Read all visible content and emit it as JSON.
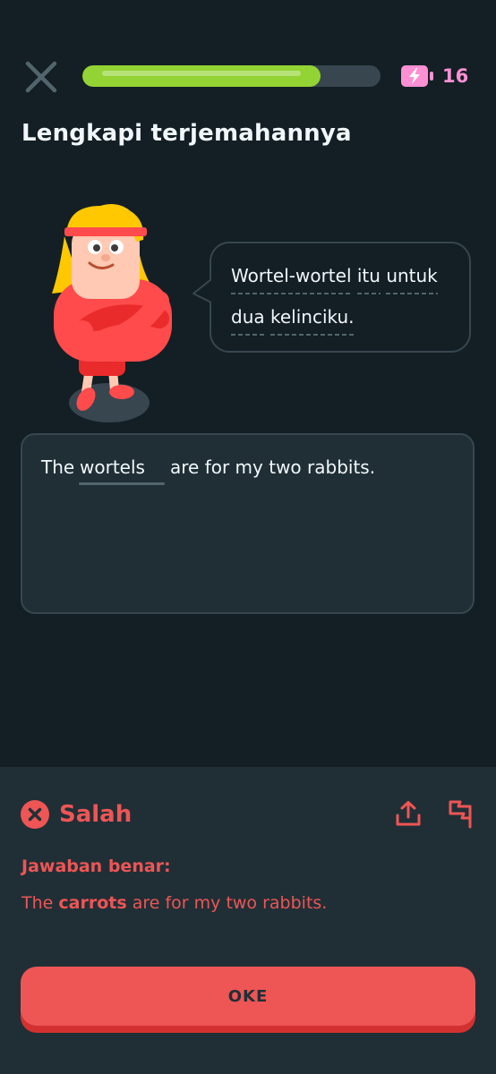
{
  "header": {
    "progress": 0.8,
    "energy_count": "16",
    "icons": {
      "close": "close-icon",
      "energy": "energy-battery-icon"
    }
  },
  "challenge": {
    "title": "Lengkapi terjemahannya",
    "prompt": {
      "line1_words": [
        "Wortel-wortel",
        "itu",
        "untuk"
      ],
      "line2_words": [
        "dua",
        "kelinciku."
      ]
    },
    "sentence_before": "The",
    "user_answer": "wortels",
    "sentence_after": "are for my two rabbits."
  },
  "feedback": {
    "status": "Salah",
    "correct_label": "Jawaban benar:",
    "correct_before": "The",
    "correct_highlight": "carrots",
    "correct_after": "are for my two rabbits.",
    "icons": {
      "status": "wrong-x-icon",
      "share": "share-icon",
      "report": "flag-icon"
    },
    "color": "#ee5555"
  },
  "actions": {
    "ok_label": "OKE"
  }
}
